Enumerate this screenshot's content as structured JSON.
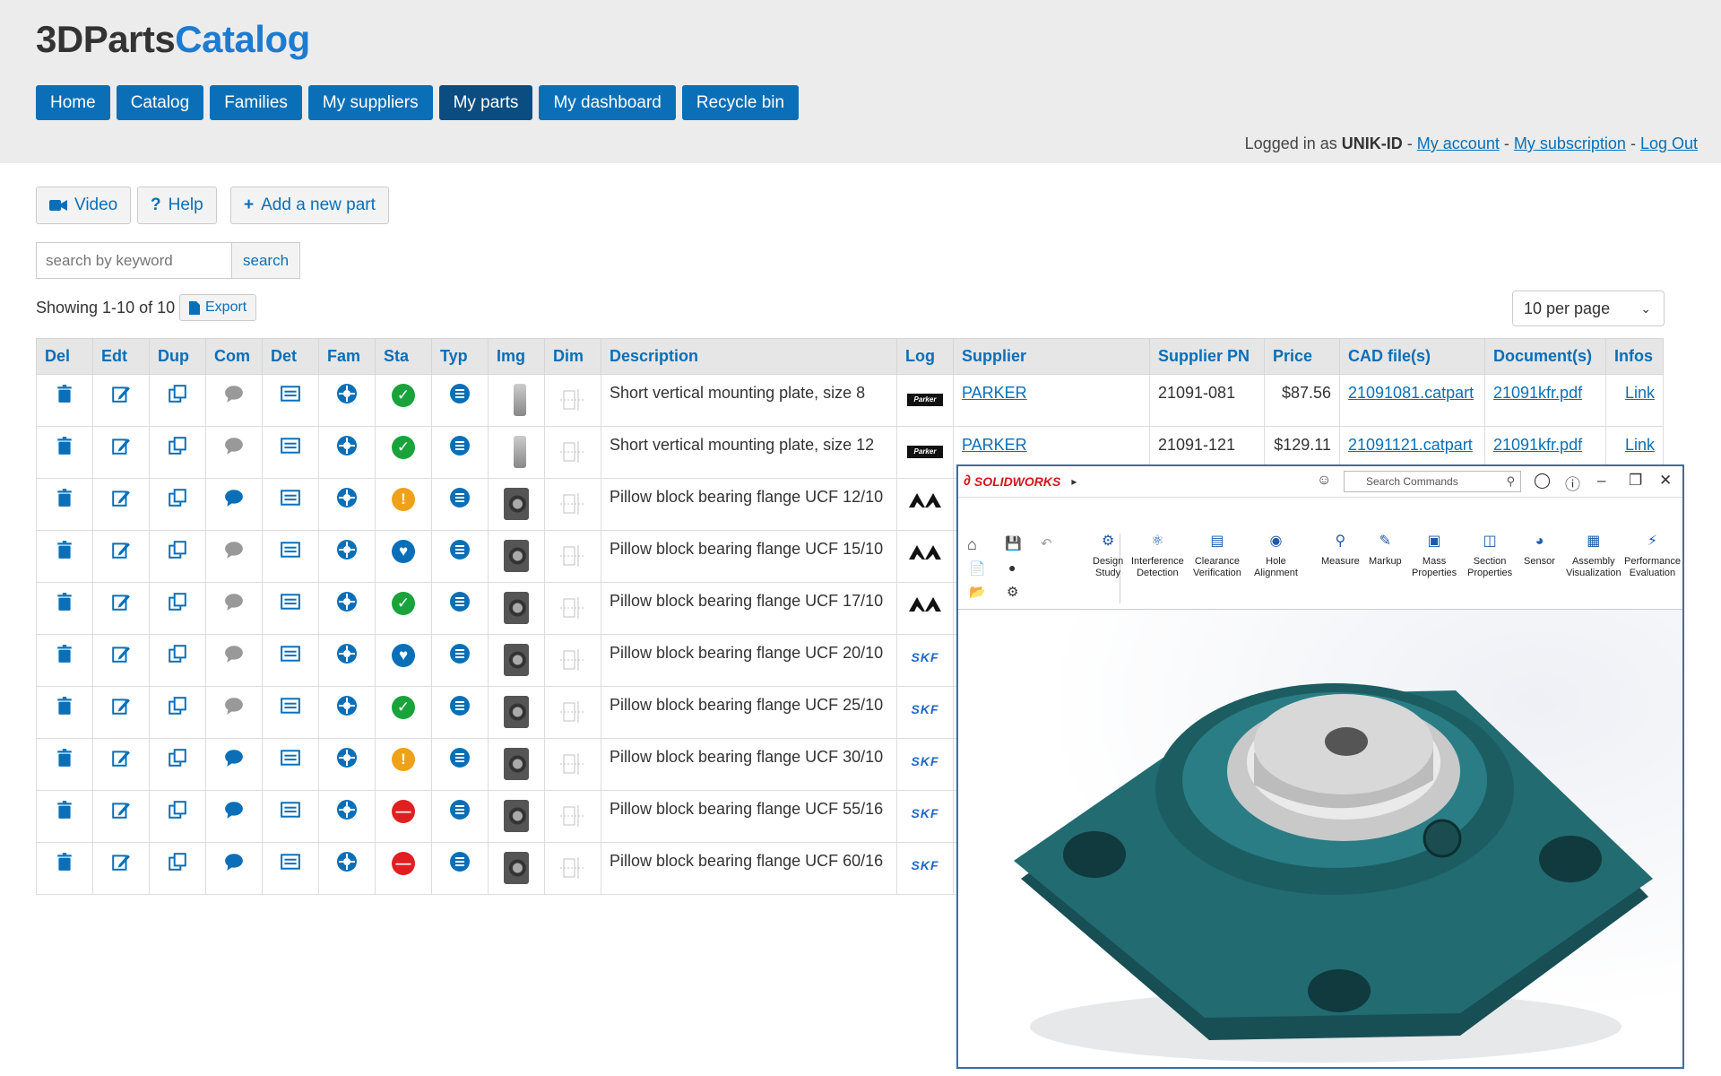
{
  "brand": {
    "part1": "3DParts",
    "part2": "Catalog"
  },
  "nav": [
    "Home",
    "Catalog",
    "Families",
    "My suppliers",
    "My parts",
    "My dashboard",
    "Recycle bin"
  ],
  "nav_active": "My parts",
  "login": {
    "prefix": "Logged in as",
    "user": "UNIK-ID",
    "sep": "-",
    "my_account": "My account",
    "my_subscription": "My subscription",
    "logout": "Log Out"
  },
  "toolbar": {
    "video": "Video",
    "help": "Help",
    "add": "Add a new part"
  },
  "search": {
    "placeholder": "search by keyword",
    "button": "search"
  },
  "listing": {
    "showing": "Showing 1-10 of 10",
    "export": "Export",
    "per_page": "10 per page"
  },
  "columns": [
    "Del",
    "Edt",
    "Dup",
    "Com",
    "Det",
    "Fam",
    "Sta",
    "Typ",
    "Img",
    "Dim",
    "Description",
    "Log",
    "Supplier",
    "Supplier PN",
    "Price",
    "CAD file(s)",
    "Document(s)",
    "Infos"
  ],
  "rows": [
    {
      "comment": false,
      "status": "ok",
      "img": "plate",
      "description": "Short vertical mounting plate, size 8",
      "logo": "parker",
      "supplier": "PARKER",
      "pn": "21091-081",
      "price": "$87.56",
      "cad": "21091081.catpart",
      "doc": "21091kfr.pdf",
      "info": "Link"
    },
    {
      "comment": false,
      "status": "ok",
      "img": "plate",
      "description": "Short vertical mounting plate, size 12",
      "logo": "parker",
      "supplier": "PARKER",
      "pn": "21091-121",
      "price": "$129.11",
      "cad": "21091121.catpart",
      "doc": "21091kfr.pdf",
      "info": "Link"
    },
    {
      "comment": true,
      "status": "warn",
      "img": "bearing",
      "description": "Pillow block bearing flange UCF 12/10",
      "logo": "mm"
    },
    {
      "comment": false,
      "status": "fav",
      "img": "bearing",
      "description": "Pillow block bearing flange UCF 15/10",
      "logo": "mm"
    },
    {
      "comment": false,
      "status": "ok",
      "img": "bearing",
      "description": "Pillow block bearing flange UCF 17/10",
      "logo": "mm"
    },
    {
      "comment": false,
      "status": "fav",
      "img": "bearing",
      "description": "Pillow block bearing flange UCF 20/10",
      "logo": "skf"
    },
    {
      "comment": false,
      "status": "ok",
      "img": "bearing",
      "description": "Pillow block bearing flange UCF 25/10",
      "logo": "skf"
    },
    {
      "comment": true,
      "status": "warn",
      "img": "bearing",
      "description": "Pillow block bearing flange UCF 30/10",
      "logo": "skf"
    },
    {
      "comment": true,
      "status": "stop",
      "img": "bearing",
      "description": "Pillow block bearing flange UCF 55/16",
      "logo": "skf"
    },
    {
      "comment": true,
      "status": "stop",
      "img": "bearing",
      "description": "Pillow block bearing flange UCF 60/16",
      "logo": "skf"
    }
  ],
  "logo_text": {
    "parker": "Parker",
    "skf": "SKF"
  },
  "solidworks": {
    "brand": "SOLIDWORKS",
    "search": "Search Commands",
    "tools": [
      {
        "l1": "Design",
        "l2": "Study"
      },
      {
        "l1": "Interference",
        "l2": "Detection"
      },
      {
        "l1": "Clearance",
        "l2": "Verification"
      },
      {
        "l1": "Hole",
        "l2": "Alignment"
      },
      {
        "l1": "Measure",
        "l2": ""
      },
      {
        "l1": "Markup",
        "l2": ""
      },
      {
        "l1": "Mass",
        "l2": "Properties"
      },
      {
        "l1": "Section",
        "l2": "Properties"
      },
      {
        "l1": "Sensor",
        "l2": ""
      },
      {
        "l1": "Assembly",
        "l2": "Visualization"
      },
      {
        "l1": "Performance",
        "l2": "Evaluation"
      }
    ]
  },
  "colors": {
    "accent": "#0a6fb7",
    "accent_dark": "#0b4d80",
    "model": "#1f5e63"
  }
}
